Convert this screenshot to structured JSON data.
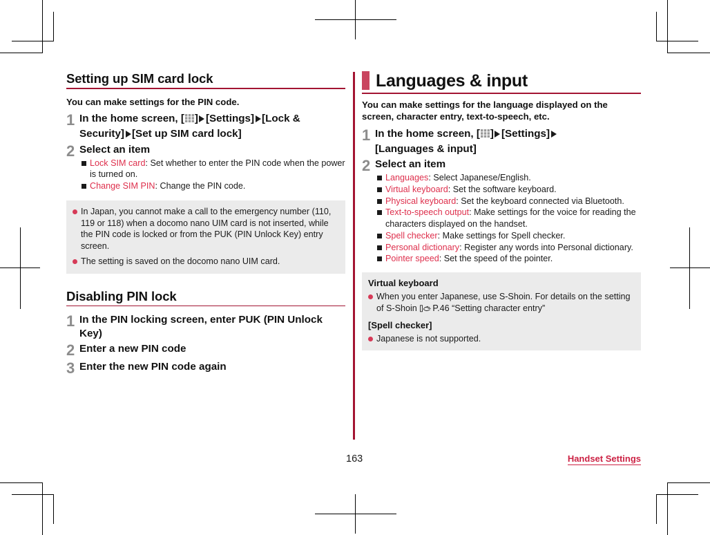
{
  "page": {
    "number": "163",
    "chapter_label": "Handset Settings"
  },
  "left_column": {
    "section_1": {
      "heading": "Setting up SIM card lock",
      "lead": "You can make settings for the PIN code.",
      "steps": [
        {
          "number": "1",
          "title_parts": [
            {
              "type": "text",
              "value": "In the home screen, ["
            },
            {
              "type": "icon",
              "value": "app-drawer-icon"
            },
            {
              "type": "text",
              "value": "]"
            },
            {
              "type": "icon",
              "value": "right-triangle-icon"
            },
            {
              "type": "text",
              "value": "[Settings]"
            },
            {
              "type": "icon",
              "value": "right-triangle-icon"
            },
            {
              "type": "text",
              "value": "[Lock & Security]"
            },
            {
              "type": "icon",
              "value": "right-triangle-icon"
            },
            {
              "type": "text",
              "value": "[Set up SIM card lock]"
            }
          ],
          "subs": []
        },
        {
          "number": "2",
          "title": "Select an item",
          "subs": [
            {
              "key": "Lock SIM card",
              "desc": ": Set whether to enter the PIN code when the power is turned on."
            },
            {
              "key": "Change SIM PIN",
              "desc": ": Change the PIN code."
            }
          ]
        }
      ],
      "note": {
        "items": [
          "In Japan, you cannot make a call to the emergency number (110, 119 or 118) when a docomo nano UIM card is not inserted, while the PIN code is locked or from the PUK (PIN Unlock Key) entry screen.",
          "The setting is saved on the docomo nano UIM card."
        ]
      }
    },
    "section_2": {
      "heading": "Disabling PIN lock",
      "steps": [
        {
          "number": "1",
          "title": "In the PIN locking screen, enter PUK (PIN Unlock Key)"
        },
        {
          "number": "2",
          "title": "Enter a new PIN code"
        },
        {
          "number": "3",
          "title": "Enter the new PIN code again"
        }
      ]
    }
  },
  "right_column": {
    "heading": "Languages & input",
    "lead": "You can make settings for the language displayed on the screen, character entry, text-to-speech, etc.",
    "steps": [
      {
        "number": "1",
        "title_parts": [
          {
            "type": "text",
            "value": "In the home screen, ["
          },
          {
            "type": "icon",
            "value": "app-drawer-icon"
          },
          {
            "type": "text",
            "value": "]"
          },
          {
            "type": "icon",
            "value": "right-triangle-icon"
          },
          {
            "type": "text",
            "value": "[Settings]"
          },
          {
            "type": "icon",
            "value": "right-triangle-icon"
          },
          {
            "type": "text",
            "value": "[Languages & input]"
          }
        ]
      },
      {
        "number": "2",
        "title": "Select an item",
        "subs": [
          {
            "key": "Languages",
            "desc": ": Select Japanese/English."
          },
          {
            "key": "Virtual keyboard",
            "desc": ": Set the software keyboard."
          },
          {
            "key": "Physical keyboard",
            "desc": ": Set the keyboard connected via Bluetooth."
          },
          {
            "key": "Text-to-speech output",
            "desc": ": Make settings for the voice for reading the characters displayed on the handset."
          },
          {
            "key": "Spell checker",
            "desc": ": Make settings for Spell checker."
          },
          {
            "key": "Personal dictionary",
            "desc": ": Register any words into Personal dictionary."
          },
          {
            "key": "Pointer speed",
            "desc": ": Set the speed of the pointer."
          }
        ]
      }
    ],
    "note": {
      "title_1": "Virtual keyboard",
      "item_1_pre": "When you enter Japanese, use S-Shoin. For details on the setting of S-Shoin ",
      "item_1_post": "P.46 “Setting character entry”",
      "title_2": "[Spell checker]",
      "item_2": "Japanese is not supported."
    }
  },
  "colors": {
    "accent_red": "#de2f4c",
    "rule_dark": "#a31432",
    "chapter_block": "#c9455f",
    "note_bg": "#ebebeb",
    "step_number": "#8c8c8c",
    "footer_link": "#cc2244"
  }
}
